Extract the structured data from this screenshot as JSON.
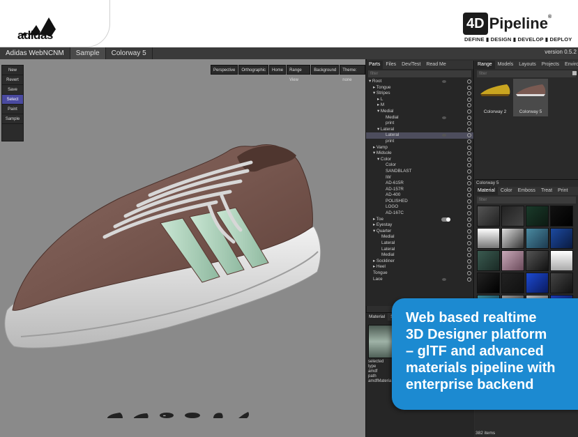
{
  "brand": {
    "adidas": "adidas",
    "pipeline_badge": "4D",
    "pipeline_word": "Pipeline",
    "pipeline_registered": "®",
    "pipeline_tagline": "DEFINE ▮ DESIGN ▮ DEVELOP ▮ DEPLOY"
  },
  "topbar": {
    "tabs": [
      "Adidas WebNCNM",
      "Sample",
      "Colorway 5"
    ],
    "version": "version 0.5.2"
  },
  "toolbox": {
    "buttons": [
      "New",
      "Revert",
      "Save",
      "Select",
      "Paint",
      "Sample"
    ],
    "active": "Select"
  },
  "viewbar": {
    "buttons": [
      "Perspective",
      "Orthographic",
      "Home",
      "Range View",
      "Background",
      "Theme: none"
    ]
  },
  "parts": {
    "tabs": [
      "Parts",
      "Files",
      "Dev/Test",
      "Read Me"
    ],
    "filter_placeholder": "filter",
    "tree": [
      "▾ Root",
      "▸ Tongue",
      "▾ Stripes",
      "▸ L",
      "▸ M",
      "▾ Medial",
      "Medial",
      "print",
      "▾ Lateral",
      "Lateral",
      "print",
      "▸ Vamp",
      "▾ Midsole",
      "▾ Color",
      "Color",
      "SANDBLAST",
      "IW",
      "AD-615R",
      "AD-157R",
      "AD-400",
      "POLISHED",
      "LOGO",
      "AD-167C",
      "▸ Toe",
      "▸ Eyestay",
      "▾ Quarter",
      "Medial",
      "Lateral",
      "Lateral",
      "Medial",
      "▸ Sockliner",
      "▸ Heel",
      "Tongue",
      "Lace"
    ]
  },
  "range": {
    "tabs": [
      "Range",
      "Models",
      "Layouts",
      "Projects",
      "Enviro"
    ],
    "filter_placeholder": "filter",
    "cards": [
      "Colorway 2",
      "Colorway 5"
    ]
  },
  "materials": {
    "section_label": "Colorway 5",
    "tabs": [
      "Material",
      "Color",
      "Emboss",
      "Treat",
      "Print"
    ],
    "filter_placeholder": "filter",
    "count": "382 items"
  },
  "material_detail": {
    "tabs": [
      "Material",
      "S"
    ],
    "info": [
      "selected",
      "type",
      "amdf",
      "path",
      "amdfMateria"
    ],
    "ellipsis": "..."
  },
  "callout": {
    "lines": [
      "Web based realtime",
      "3D Designer platform",
      "– glTF and advanced",
      "materials pipeline with",
      "enterprise backend"
    ]
  }
}
